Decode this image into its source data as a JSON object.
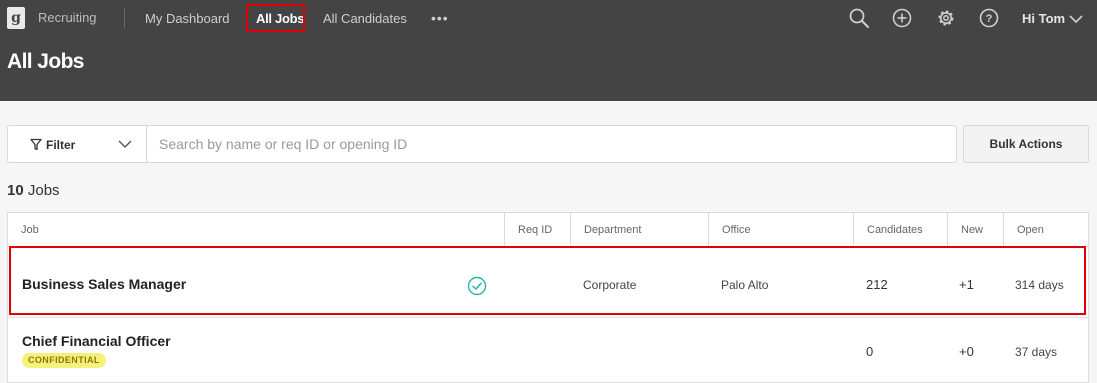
{
  "nav": {
    "logo_letter": "g",
    "brand": "Recruiting",
    "links": [
      "My Dashboard",
      "All Jobs",
      "All Candidates"
    ],
    "more": "•••",
    "greeting": "Hi Tom",
    "icons": [
      "search-icon",
      "plus-circle-icon",
      "gear-icon",
      "help-icon",
      "chevron-down-icon"
    ]
  },
  "page": {
    "title": "All Jobs"
  },
  "toolbar": {
    "filter_label": "Filter",
    "search_placeholder": "Search by name or req ID or opening ID",
    "bulk_label": "Bulk Actions"
  },
  "summary": {
    "count": "10",
    "label": "Jobs"
  },
  "table": {
    "columns": [
      "Job",
      "Req ID",
      "Department",
      "Office",
      "Candidates",
      "New",
      "Open"
    ],
    "rows": [
      {
        "job": "Business Sales Manager",
        "badge": "",
        "req_id": "",
        "department": "Corporate",
        "office": "Palo Alto",
        "candidates": "212",
        "new": "+1",
        "open": "314 days",
        "status_icon": "check-circle-icon"
      },
      {
        "job": "Chief Financial Officer",
        "badge": "CONFIDENTIAL",
        "req_id": "",
        "department": "",
        "office": "",
        "candidates": "0",
        "new": "+0",
        "open": "37 days"
      }
    ]
  },
  "colors": {
    "header_bg": "#444444",
    "highlight": "#e20000",
    "check": "#26b5a8",
    "badge_bg": "#f4f27c"
  }
}
